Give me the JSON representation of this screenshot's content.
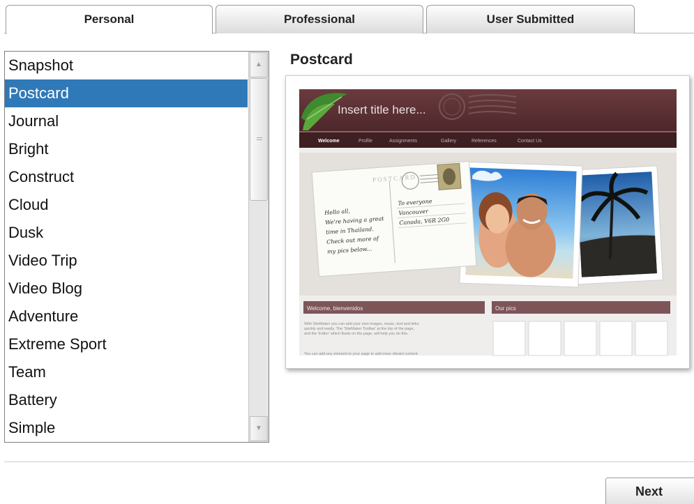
{
  "tabs": [
    {
      "label": "Personal",
      "active": true
    },
    {
      "label": "Professional",
      "active": false
    },
    {
      "label": "User Submitted",
      "active": false
    }
  ],
  "templates": [
    "Snapshot",
    "Postcard",
    "Journal",
    "Bright",
    "Construct",
    "Cloud",
    "Dusk",
    "Video Trip",
    "Video Blog",
    "Adventure",
    "Extreme Sport",
    "Team",
    "Battery",
    "Simple"
  ],
  "selected_template": "Postcard",
  "preview": {
    "title": "Postcard",
    "site_title_placeholder": "Insert title here...",
    "nav_items": [
      "Welcome",
      "Profile",
      "Assignments",
      "Gallery",
      "References",
      "Contact Us"
    ],
    "postcard_stamp_word": "POSTCARD",
    "postcard_message": [
      "Hello all,",
      "We're having a great",
      "time in Thailand.",
      "Check out more of",
      "my pics below..."
    ],
    "postcard_address": [
      "To everyone",
      "Vancouver",
      "Canada, V6R 2G0"
    ],
    "welcome_heading": "Welcome, bienvenidos",
    "welcome_text": [
      "With SiteMaker you can add your own images, music, text and links",
      "quickly and easily. The 'SiteMaker Toolbar' at the top of the page,",
      "and the 'Editor' which floats on the page, will help you do this."
    ],
    "welcome_text_more": "You can add any element to your page to add more vibrant content.",
    "pics_heading": "Our pics"
  },
  "footer": {
    "next_label": "Next"
  },
  "colors": {
    "selection": "#3079b8",
    "header_brown": "#5a2f33",
    "section_bar": "#7d5558"
  }
}
